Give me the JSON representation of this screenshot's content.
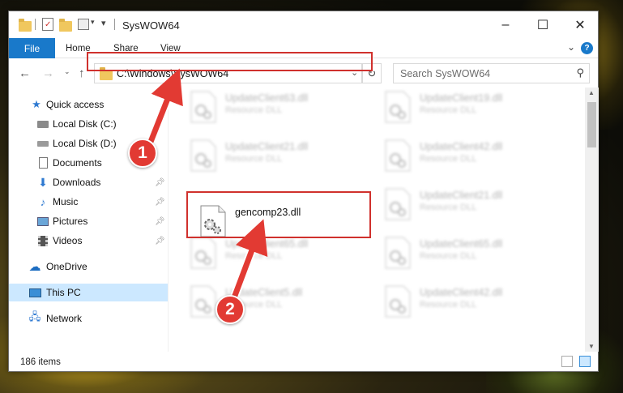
{
  "window": {
    "title": "SysWOW64",
    "min_label": "–",
    "max_label": "☐",
    "close_label": "✕"
  },
  "ribbon": {
    "file": "File",
    "home": "Home",
    "share": "Share",
    "view": "View",
    "help": "?"
  },
  "address": {
    "path": "C:\\Windows\\SysWOW64",
    "search_placeholder": "Search SysWOW64"
  },
  "sidebar": {
    "items": [
      {
        "label": "Quick access",
        "icon": "star-icon"
      },
      {
        "label": "Local Disk (C:)",
        "icon": "drive-icon"
      },
      {
        "label": "Local Disk (D:)",
        "icon": "drive-icon"
      },
      {
        "label": "Documents",
        "icon": "documents-icon"
      },
      {
        "label": "Downloads",
        "icon": "download-icon"
      },
      {
        "label": "Music",
        "icon": "music-icon"
      },
      {
        "label": "Pictures",
        "icon": "pictures-icon"
      },
      {
        "label": "Videos",
        "icon": "videos-icon"
      },
      {
        "label": "OneDrive",
        "icon": "cloud-icon"
      },
      {
        "label": "This PC",
        "icon": "computer-icon"
      },
      {
        "label": "Network",
        "icon": "network-icon"
      }
    ]
  },
  "files": [
    {
      "name": "UpdateClient63.dll",
      "type": "Resource DLL"
    },
    {
      "name": "UpdateClient19.dll",
      "type": "Resource DLL"
    },
    {
      "name": "UpdateClient21.dll",
      "type": "Resource DLL"
    },
    {
      "name": "UpdateClient42.dll",
      "type": "Resource DLL"
    },
    {
      "name": "gencomp23.dll",
      "type": ""
    },
    {
      "name": "UpdateClient21.dll",
      "type": "Resource DLL"
    },
    {
      "name": "UpdateClient65.dll",
      "type": "Resource DLL"
    },
    {
      "name": "UpdateClient65.dll",
      "type": "Resource DLL"
    },
    {
      "name": "UpdateClient5.dll",
      "type": "Resource DLL"
    },
    {
      "name": "UpdateClient42.dll",
      "type": "Resource DLL"
    }
  ],
  "status": {
    "items": "186 items"
  },
  "callouts": {
    "one": "1",
    "two": "2"
  },
  "colors": {
    "accent": "#1979ca",
    "highlight": "#d0312d",
    "selected": "#cce8ff"
  }
}
